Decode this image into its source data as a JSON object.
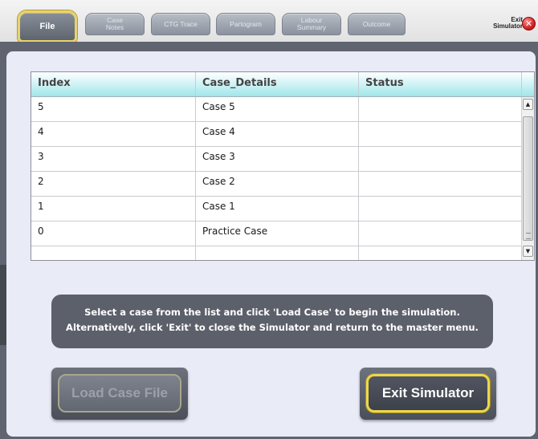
{
  "tabs": [
    {
      "label": "File",
      "active": true
    },
    {
      "label": "Case\nNotes",
      "active": false
    },
    {
      "label": "CTG Trace",
      "active": false
    },
    {
      "label": "Partogram",
      "active": false
    },
    {
      "label": "Labour\nSummary",
      "active": false
    },
    {
      "label": "Outcome",
      "active": false
    }
  ],
  "window": {
    "exit_label": "Exit\nSimulator",
    "exit_icon": "close-x-icon",
    "exit_glyph": "✕"
  },
  "table": {
    "columns": [
      "Index",
      "Case_Details",
      "Status"
    ],
    "rows": [
      {
        "index": "5",
        "details": "Case 5",
        "status": ""
      },
      {
        "index": "4",
        "details": "Case 4",
        "status": ""
      },
      {
        "index": "3",
        "details": "Case 3",
        "status": ""
      },
      {
        "index": "2",
        "details": "Case 2",
        "status": ""
      },
      {
        "index": "1",
        "details": "Case 1",
        "status": ""
      },
      {
        "index": "0",
        "details": "Practice Case",
        "status": ""
      },
      {
        "index": "",
        "details": "",
        "status": ""
      }
    ],
    "scroll_up_glyph": "▲",
    "scroll_down_glyph": "▼"
  },
  "info": {
    "line1": "Select a case from the list and click 'Load Case' to begin the simulation.",
    "line2": "Alternatively, click 'Exit' to close the Simulator and return to the master menu."
  },
  "buttons": {
    "load_label": "Load Case File",
    "load_enabled": false,
    "exit_label": "Exit Simulator"
  },
  "colors": {
    "panel": "#e9ebf7",
    "frame": "#5f6470",
    "header_gradient_end": "#9fe6ea",
    "accent_gold": "#ecd74e",
    "exit_red": "#d21d1d"
  }
}
